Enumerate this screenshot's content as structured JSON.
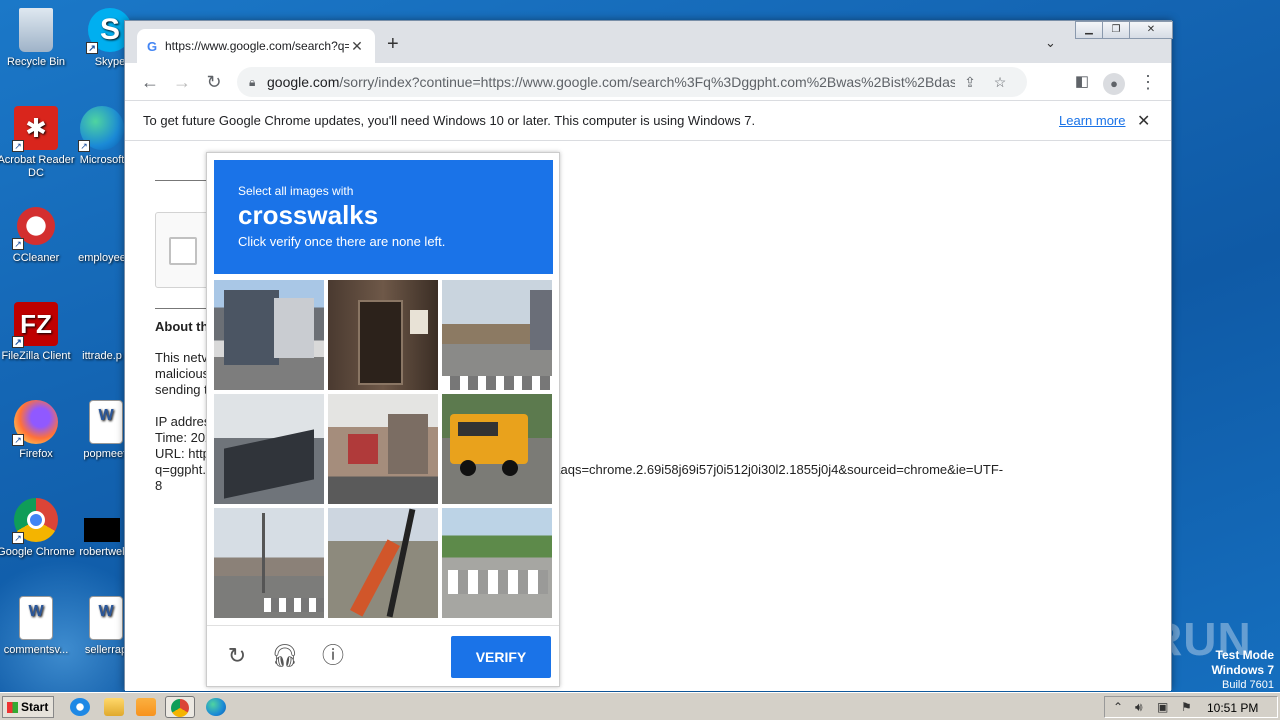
{
  "desktop": {
    "icons": [
      {
        "label": "Recycle Bin"
      },
      {
        "label": "Skype"
      },
      {
        "label": "Acrobat Reader DC"
      },
      {
        "label": "Microsoft"
      },
      {
        "label": "CCleaner"
      },
      {
        "label": "employee"
      },
      {
        "label": "FileZilla Client"
      },
      {
        "label": "ittrade.p"
      },
      {
        "label": "Firefox"
      },
      {
        "label": "popmeeti"
      },
      {
        "label": "Google Chrome"
      },
      {
        "label": "robertwel"
      },
      {
        "label": "commentsv..."
      },
      {
        "label": "sellerrap"
      }
    ],
    "watermark": "ANY RUN",
    "test_mode": {
      "line1": "Test Mode",
      "line2": "Windows 7",
      "line3": "Build 7601"
    }
  },
  "browser": {
    "tab_title": "https://www.google.com/search?q=",
    "new_tab_label": "+",
    "address": {
      "host": "google.com",
      "path": "/sorry/index?continue=https://www.google.com/search%3Fq%3Dggpht.com%2Bwas%2Bist%2Bdas..."
    },
    "infobar": {
      "message": "To get future Google Chrome updates, you'll need Windows 10 or later. This computer is using Windows 7.",
      "link": "Learn more"
    }
  },
  "page": {
    "about_heading": "About th",
    "para1": [
      "This netv",
      "malicious",
      "sending t"
    ],
    "details": [
      "IP addres",
      "Time: 202",
      "URL: http",
      "q=ggpht.",
      "8"
    ],
    "url_tail": "n+&aqs=chrome.2.69i58j69i57j0i512j0i30l2.1855j0j4&sourceid=chrome&ie=UTF-"
  },
  "captcha": {
    "line1": "Select all images with",
    "keyword": "crosswalks",
    "line3": "Click verify once there are none left.",
    "verify_label": "VERIFY",
    "tiles": [
      {
        "name": "house-street"
      },
      {
        "name": "gate-door"
      },
      {
        "name": "street-crosswalk"
      },
      {
        "name": "damaged-house"
      },
      {
        "name": "city-buildings"
      },
      {
        "name": "school-bus"
      },
      {
        "name": "intersection-crosswalk"
      },
      {
        "name": "construction-excavator"
      },
      {
        "name": "road-crosswalk"
      }
    ]
  },
  "taskbar": {
    "start_label": "Start",
    "clock": "10:51 PM"
  }
}
